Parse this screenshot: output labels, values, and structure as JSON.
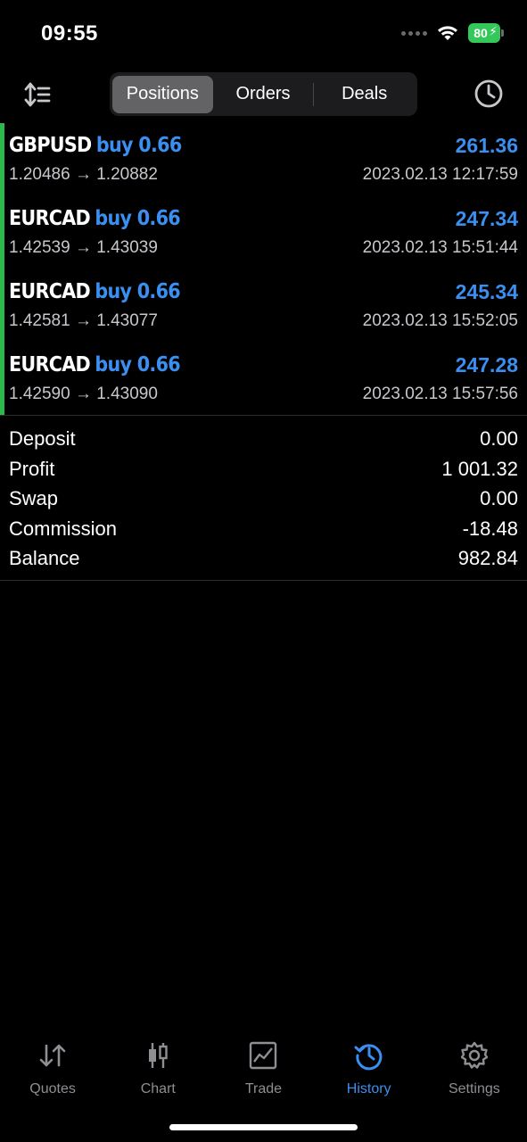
{
  "status_bar": {
    "time": "09:55",
    "battery": "80"
  },
  "toolbar": {
    "tabs": [
      {
        "label": "Positions",
        "active": true
      },
      {
        "label": "Orders",
        "active": false
      },
      {
        "label": "Deals",
        "active": false
      }
    ]
  },
  "positions": [
    {
      "symbol": "GBPUSD",
      "type": "buy 0.66",
      "profit": "261.36",
      "prices": "1.20486 → 1.20882",
      "time": "2023.02.13 12:17:59"
    },
    {
      "symbol": "EURCAD",
      "type": "buy 0.66",
      "profit": "247.34",
      "prices": "1.42539 → 1.43039",
      "time": "2023.02.13 15:51:44"
    },
    {
      "symbol": "EURCAD",
      "type": "buy 0.66",
      "profit": "245.34",
      "prices": "1.42581 → 1.43077",
      "time": "2023.02.13 15:52:05"
    },
    {
      "symbol": "EURCAD",
      "type": "buy 0.66",
      "profit": "247.28",
      "prices": "1.42590 → 1.43090",
      "time": "2023.02.13 15:57:56"
    }
  ],
  "summary": [
    {
      "label": "Deposit",
      "value": "0.00"
    },
    {
      "label": "Profit",
      "value": "1 001.32"
    },
    {
      "label": "Swap",
      "value": "0.00"
    },
    {
      "label": "Commission",
      "value": "-18.48"
    },
    {
      "label": "Balance",
      "value": "982.84"
    }
  ],
  "tabbar": [
    {
      "label": "Quotes",
      "icon": "quotes-arrows-icon",
      "active": false
    },
    {
      "label": "Chart",
      "icon": "candlestick-icon",
      "active": false
    },
    {
      "label": "Trade",
      "icon": "trade-chart-icon",
      "active": false
    },
    {
      "label": "History",
      "icon": "history-clock-icon",
      "active": true
    },
    {
      "label": "Settings",
      "icon": "gear-icon",
      "active": false
    }
  ],
  "colors": {
    "accent": "#3a8ff0",
    "position_marker": "#2db84c",
    "battery": "#34c759"
  }
}
